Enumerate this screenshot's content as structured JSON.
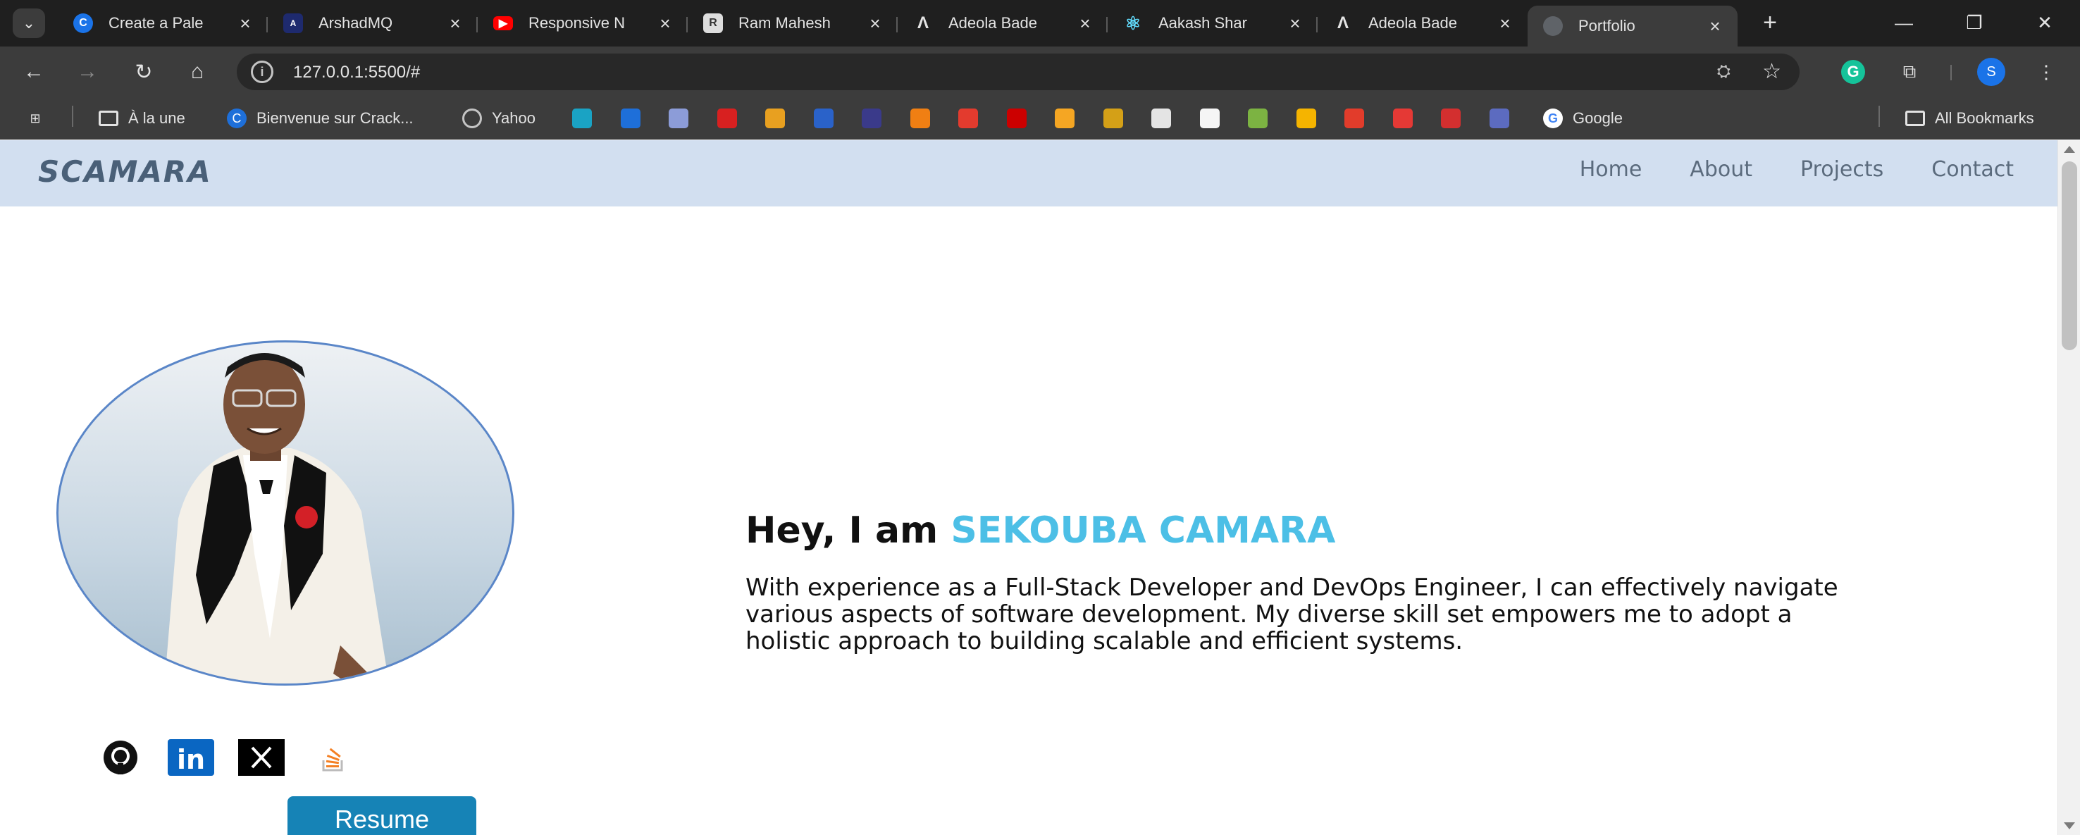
{
  "browser": {
    "tabs": [
      {
        "title": "Create a Pale",
        "favicon": "chrome-icon",
        "color": "#1a73e8",
        "active": false
      },
      {
        "title": "ArshadMQ",
        "favicon": "arshad-icon",
        "color": "#1e2a6e",
        "active": false
      },
      {
        "title": "Responsive N",
        "favicon": "youtube-icon",
        "color": "#ff0000",
        "active": false
      },
      {
        "title": "Ram Mahesh",
        "favicon": "ram-icon",
        "color": "#dddddd",
        "active": false
      },
      {
        "title": "Adeola Bade",
        "favicon": "adeola-icon",
        "color": "#1f1f1f",
        "active": false
      },
      {
        "title": "Aakash Shar",
        "favicon": "react-icon",
        "color": "#1f1f1f",
        "active": false
      },
      {
        "title": "Adeola Bade",
        "favicon": "adeola-icon",
        "color": "#1f1f1f",
        "active": false
      },
      {
        "title": "Portfolio",
        "favicon": "globe-icon",
        "color": "#5f6368",
        "active": true
      }
    ],
    "url": "127.0.0.1:5500/#",
    "bookmarks": [
      {
        "label": "À la une",
        "icon": "folder-icon"
      },
      {
        "label": "Bienvenue sur Crack...",
        "icon": "crackmes-icon"
      },
      {
        "label": "Yahoo",
        "icon": "globe-icon"
      },
      {
        "label": "Google",
        "icon": "google-icon"
      }
    ],
    "bookmark_icons": [
      "#1aa3c4",
      "#1e6fd9",
      "#8c9cd8",
      "#d82020",
      "#e8a020",
      "#2a62c9",
      "#3a3a8a",
      "#f07f13",
      "#e33b2e",
      "#cc0000",
      "#f5a623",
      "#d4a017",
      "#e4e4e4",
      "#f5f5f5",
      "#7cb342",
      "#f5b400",
      "#e23c2b",
      "#e53935",
      "#d32f2f",
      "#5c6bc0"
    ],
    "all_bookmarks": "All Bookmarks",
    "profile_initial": "S"
  },
  "site": {
    "logo": "SCAMARA",
    "nav": [
      "Home",
      "About",
      "Projects",
      "Contact"
    ],
    "greeting": "Hey, I am ",
    "name": "SEKOUBA CAMARA",
    "bio": "With experience as a Full-Stack Developer and DevOps Engineer, I can effectively navigate various aspects of software development. My diverse skill set empowers me to adopt a holistic approach to building scalable and efficient systems.",
    "socials": [
      "github-icon",
      "linkedin-icon",
      "x-icon",
      "stackoverflow-icon"
    ],
    "resume_label": "Resume",
    "accent_color": "#4cbfe6"
  }
}
